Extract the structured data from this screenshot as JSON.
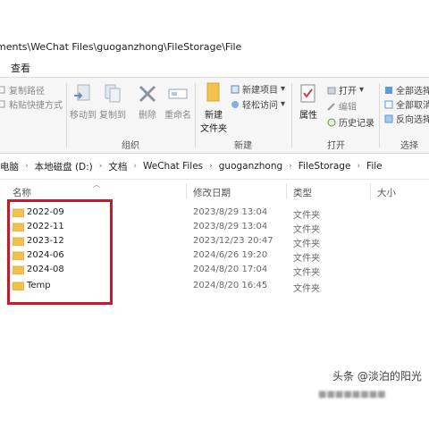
{
  "title": "ments\\WeChat Files\\guoganzhong\\FileStorage\\File",
  "menu": {
    "view": "查看"
  },
  "ribbon": {
    "copy_path": "复制路径",
    "paste_shortcut": "粘贴快捷方式",
    "move_to": "移动到",
    "copy_to": "复制到",
    "delete": "删除",
    "rename": "重命名",
    "org_group": "组织",
    "new_item": "新建项目",
    "easy_access": "轻松访问",
    "new_folder_line1": "新建",
    "new_folder_line2": "文件夹",
    "new_group": "新建",
    "properties": "属性",
    "open": "打开",
    "edit": "编辑",
    "history": "历史记录",
    "open_group": "打开",
    "select_all": "全部选择",
    "select_none": "全部取消",
    "invert_selection": "反向选择",
    "select_group": "选择"
  },
  "address": {
    "crumbs": [
      "电脑",
      "本地磁盘 (D:)",
      "文档",
      "WeChat Files",
      "guoganzhong",
      "FileStorage",
      "File"
    ]
  },
  "columns": {
    "name": "名称",
    "date": "修改日期",
    "type": "类型",
    "size": "大小"
  },
  "files": [
    {
      "name": "2022-09",
      "date": "2023/8/29 13:04",
      "type": "文件夹"
    },
    {
      "name": "2022-11",
      "date": "2023/8/29 13:04",
      "type": "文件夹"
    },
    {
      "name": "2023-12",
      "date": "2023/12/23 20:47",
      "type": "文件夹"
    },
    {
      "name": "2024-06",
      "date": "2024/6/26 19:20",
      "type": "文件夹"
    },
    {
      "name": "2024-08",
      "date": "2024/8/20 17:04",
      "type": "文件夹"
    },
    {
      "name": "Temp",
      "date": "2024/8/20 16:45",
      "type": "文件夹"
    }
  ],
  "watermark": "头条 @淡泊的阳光",
  "colors": {
    "folder": "#f2c14e",
    "highlight": "#c41a2a",
    "accent": "#1a73c8"
  }
}
